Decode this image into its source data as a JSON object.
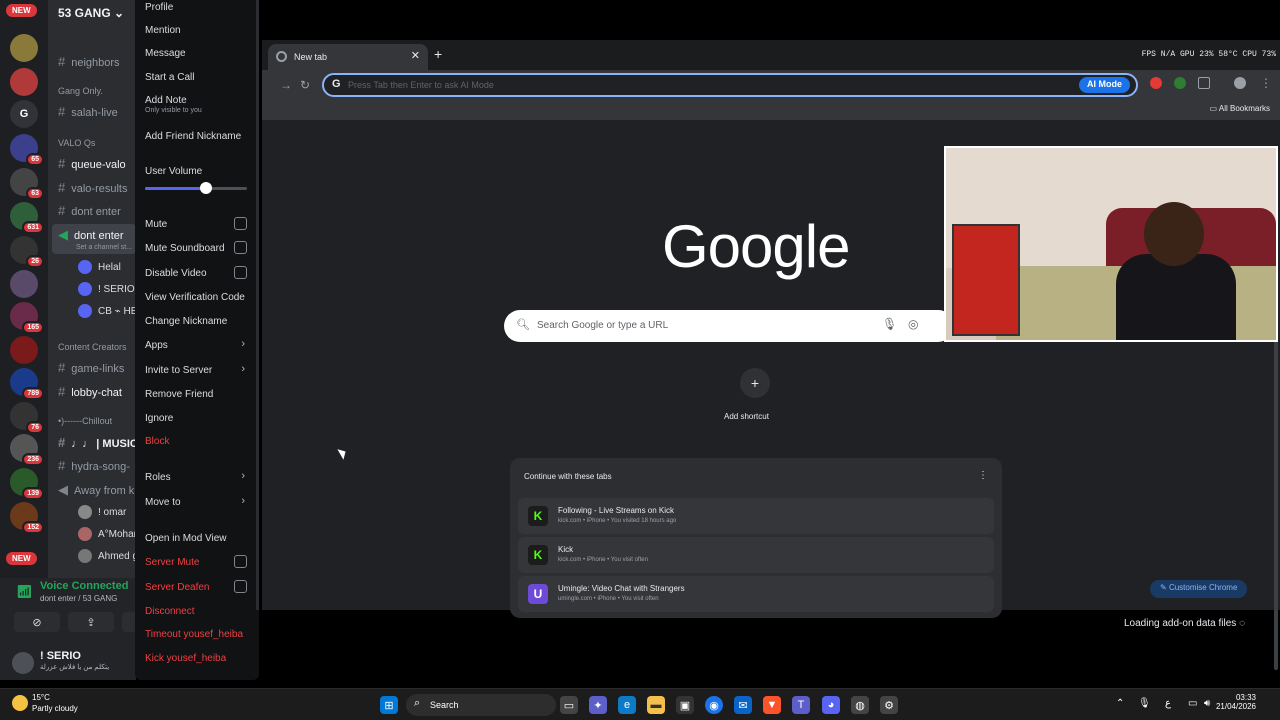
{
  "discord": {
    "guild_name": "53 GANG",
    "new_badge": "NEW",
    "rail_badges": [
      "65",
      "63",
      "631",
      "26",
      "165",
      "789",
      "76",
      "236",
      "139",
      "152"
    ],
    "rail_new_bottom": "NEW",
    "channels": {
      "neighbors": "neighbors",
      "cat_gang_only": "Gang Only.",
      "salah_live": "salah-live",
      "cat_valo": "VALO Qs",
      "queue_valo": "queue-valo",
      "valo_results": "valo-results",
      "dont_enter_1": "dont enter",
      "dont_enter_active": "dont enter",
      "dont_enter_sub": "Set a channel st...",
      "voice_users_1": [
        "Helal",
        "! SERIO",
        "CB ⌁ HE"
      ],
      "cat_creators": "Content Creators",
      "game_links": "game-links",
      "lobby_chat": "lobby-chat",
      "cat_chillout": "•)------Chillout",
      "music": "♩♩ | MUSIC-C",
      "hydra": "hydra-song-",
      "away": "Away from k",
      "voice_users_2": [
        "! omar",
        "A°Mohar",
        "Ahmed g"
      ]
    },
    "voice": {
      "title": "Voice Connected",
      "sub": "dont enter / 53 GANG"
    },
    "user": {
      "name": "! SERIO",
      "status": "يتكلم من يا فلاش عزرلة"
    }
  },
  "context_menu": {
    "profile": "Profile",
    "mention": "Mention",
    "message": "Message",
    "start_call": "Start a Call",
    "add_note": "Add Note",
    "add_note_hint": "Only visible to you",
    "add_friend_nickname": "Add Friend Nickname",
    "user_volume": "User Volume",
    "user_volume_level": 0.6,
    "mute": "Mute",
    "mute_soundboard": "Mute Soundboard",
    "disable_video": "Disable Video",
    "view_verification": "View Verification Code",
    "change_nickname": "Change Nickname",
    "apps": "Apps",
    "invite_to_server": "Invite to Server",
    "remove_friend": "Remove Friend",
    "ignore": "Ignore",
    "block": "Block",
    "roles": "Roles",
    "move_to": "Move to",
    "open_mod_view": "Open in Mod View",
    "server_mute": "Server Mute",
    "server_deafen": "Server Deafen",
    "disconnect": "Disconnect",
    "timeout": "Timeout yousef_heiba",
    "kick": "Kick yousef_heiba"
  },
  "browser": {
    "tab_title": "New tab",
    "stats": "FPS N/A   GPU 23% 58°C   CPU 73%",
    "omnibox_placeholder": "Press Tab then Enter to ask AI Mode",
    "ai_mode": "AI Mode",
    "all_bookmarks": "All Bookmarks",
    "logo": "Google",
    "search_placeholder": "Search Google or type a URL",
    "add_shortcut": "Add shortcut",
    "continue_title": "Continue with these tabs",
    "tabs": [
      {
        "title": "Following - Live Streams on Kick",
        "sub": "kick.com • iPhone • You visited 18 hours ago",
        "icon": "K"
      },
      {
        "title": "Kick",
        "sub": "kick.com • iPhone • You visit often",
        "icon": "K"
      },
      {
        "title": "Umingle: Video Chat with Strangers",
        "sub": "umingle.com • iPhone • You visit often",
        "icon": "U"
      }
    ],
    "customise": "Customise Chrome"
  },
  "overlay": {
    "loading": "Loading add-on data files"
  },
  "taskbar": {
    "temp": "15°C",
    "condition": "Partly cloudy",
    "search": "Search",
    "lang": "ع",
    "time": "03:33",
    "date": "21/04/2026"
  }
}
